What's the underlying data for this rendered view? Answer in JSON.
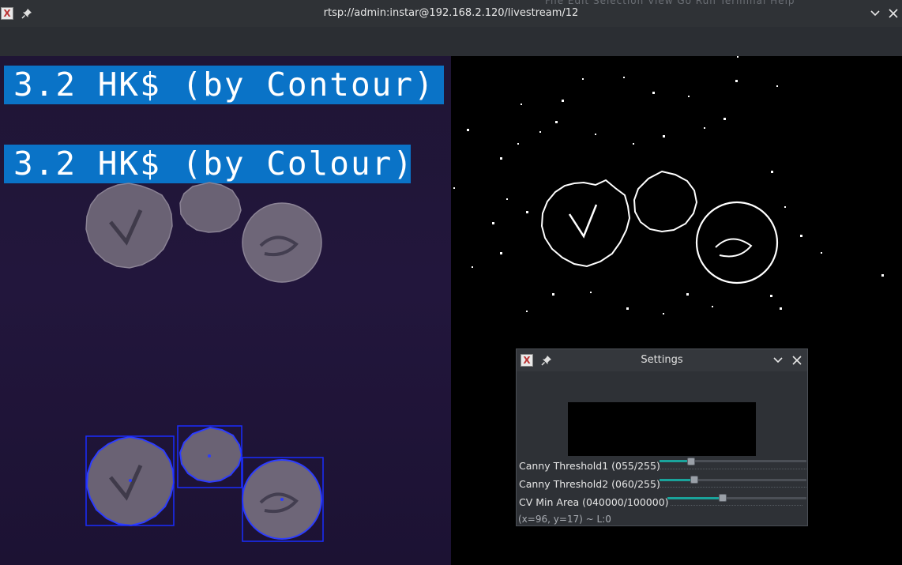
{
  "window": {
    "title": "rtsp://admin:instar@192.168.2.120/livestream/12",
    "menu_ghost": "File   Edit   Selection   View   Go   Run   Terminal   Help"
  },
  "overlay": {
    "contour_text": "3.2 HK$ (by Contour)",
    "colour_text": "3.2 HK$ (by Colour)"
  },
  "colors": {
    "banner": "#0a73c7",
    "detection_box": "#1a2cff",
    "slider_fill": "#1aa39b"
  },
  "settings": {
    "title": "Settings",
    "sliders": [
      {
        "label": "Canny Threshold1 (055/255)",
        "value": 55,
        "max": 255
      },
      {
        "label": "Canny Threshold2 (060/255)",
        "value": 60,
        "max": 255
      },
      {
        "label": "CV Min Area (040000/100000)",
        "value": 40000,
        "max": 100000
      }
    ],
    "status": "(x=96, y=17) ~ L:0"
  }
}
